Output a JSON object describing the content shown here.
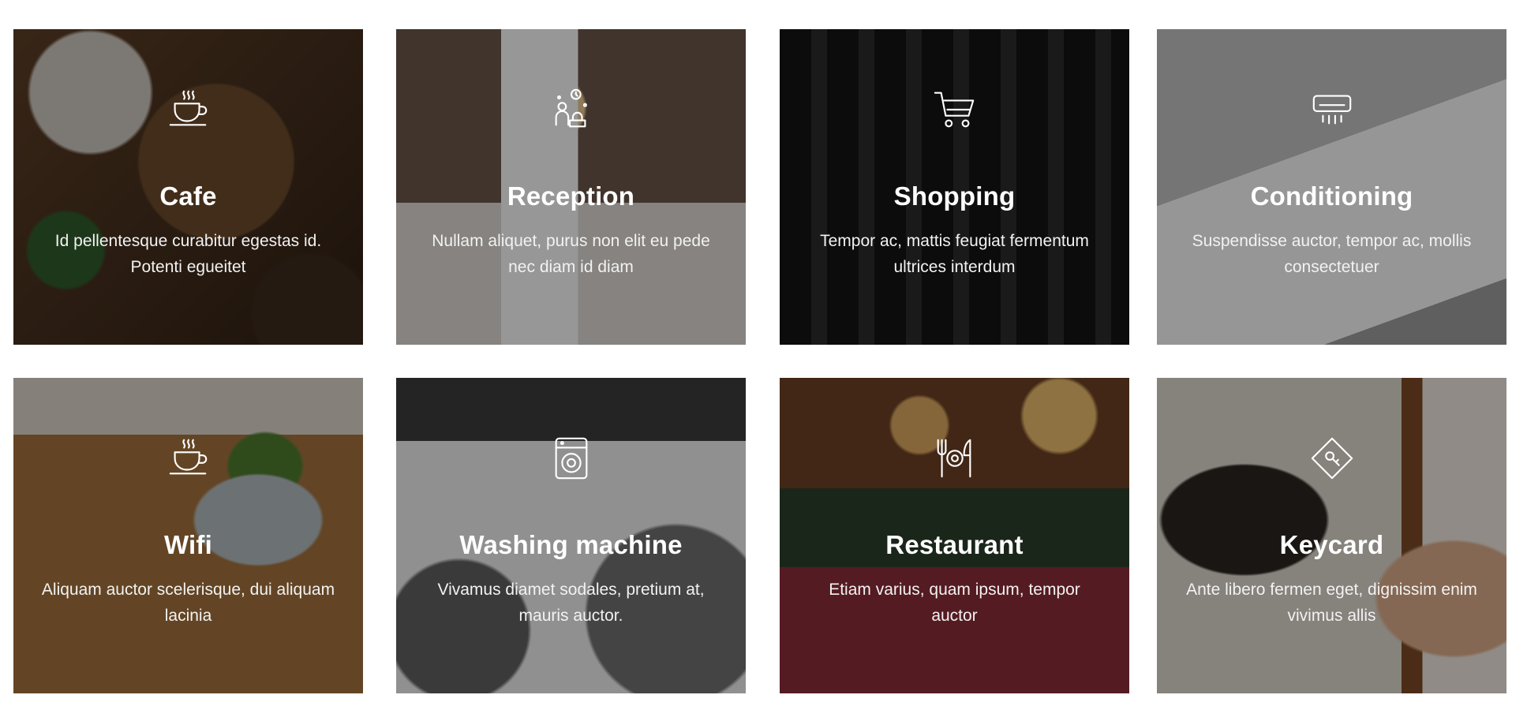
{
  "cards": [
    {
      "icon": "coffee-cup-icon",
      "title": "Cafe",
      "description": "Id pellentesque curabitur egestas id. Potenti egueitet"
    },
    {
      "icon": "reception-icon",
      "title": "Reception",
      "description": "Nullam aliquet, purus non elit eu pede nec diam id diam"
    },
    {
      "icon": "shopping-cart-icon",
      "title": "Shopping",
      "description": "Tempor ac, mattis feugiat fermentum ultrices interdum"
    },
    {
      "icon": "air-conditioner-icon",
      "title": "Conditioning",
      "description": "Suspendisse auctor, tempor ac, mollis consectetuer"
    },
    {
      "icon": "coffee-cup-icon",
      "title": "Wifi",
      "description": "Aliquam auctor scelerisque, dui aliquam lacinia"
    },
    {
      "icon": "washing-machine-icon",
      "title": "Washing machine",
      "description": "Vivamus diamet sodales, pretium at, mauris auctor."
    },
    {
      "icon": "cutlery-icon",
      "title": "Restaurant",
      "description": "Etiam varius, quam ipsum, tempor auctor"
    },
    {
      "icon": "keycard-icon",
      "title": "Keycard",
      "description": "Ante libero fermen eget, dignissim enim vivimus allis"
    }
  ]
}
